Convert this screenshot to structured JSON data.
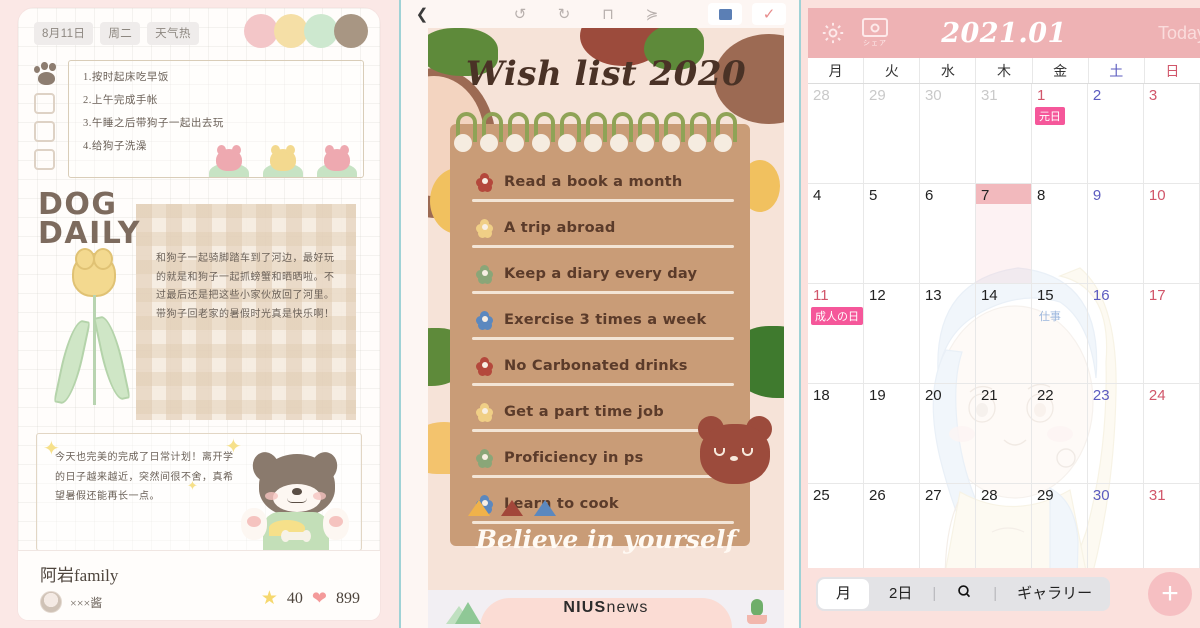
{
  "panel_journal": {
    "tags": [
      "8月11日",
      "周二",
      "天气热"
    ],
    "dot_colors": [
      "#f3c6c8",
      "#f5dfa6",
      "#cde8cf",
      "#a89683"
    ],
    "checklist": [
      "1.按时起床吃早饭",
      "2.上午完成手帐",
      "3.午睡之后带狗子一起出去玩",
      "4.给狗子洗澡"
    ],
    "title_line1": "DOG",
    "title_line2": "DAILY",
    "body_text": "和狗子一起骑脚踏车到了河边，最好玩的就是和狗子一起抓螃蟹和晒晒啦。不过最后还是把这些小家伙放回了河里。带狗子回老家的暑假时光真是快乐啊！",
    "note2_text": "今天也完美的完成了日常计划！离开学的日子越来越近，突然间很不舍，真希望暑假还能再长一点。",
    "user_name": "阿岩family",
    "sub_name": "×××酱",
    "star_count": "40",
    "heart_count": "899",
    "star_icon": "star-icon",
    "heart_icon": "heart-icon",
    "paw_icon": "paw-print-icon",
    "tulip_colors": [
      "#eea9b0",
      "#f3d98f",
      "#eea9b0"
    ]
  },
  "panel_wishlist": {
    "toolbar": [
      {
        "name": "back-arrow-icon",
        "glyph": "❮"
      },
      {
        "name": "undo-icon",
        "glyph": "↺"
      },
      {
        "name": "redo-icon",
        "glyph": "↻"
      },
      {
        "name": "crop-frame-icon",
        "glyph": "⊓"
      },
      {
        "name": "layers-icon",
        "glyph": "❯"
      }
    ],
    "title": "Wish list 2020",
    "items": [
      {
        "text": "Read a book a month",
        "dot": "#b4483c"
      },
      {
        "text": "A trip abroad",
        "dot": "#f0cf86"
      },
      {
        "text": "Keep a diary every day",
        "dot": "#8aa678"
      },
      {
        "text": "Exercise 3 times a week",
        "dot": "#5b88bf"
      },
      {
        "text": "No Carbonated drinks",
        "dot": "#b4483c"
      },
      {
        "text": "Get a part time job",
        "dot": "#f0cf86"
      },
      {
        "text": "Proficiency in ps",
        "dot": "#8aa678"
      },
      {
        "text": "Learn to cook",
        "dot": "#5b88bf"
      }
    ],
    "footer_motto": "Believe in yourself",
    "triangle_colors": [
      "#f0b24a",
      "#a2473a",
      "#5b88bf"
    ],
    "brand_bold": "NIUS",
    "brand_light": "news",
    "canvas_bg": "#f6e3d8",
    "pad_bg": "#c99c77"
  },
  "panel_calendar": {
    "gear_icon": "gear-icon",
    "camera_icon": "camera-icon",
    "camera_label": "シェア",
    "title": "2021.01",
    "today_label": "Today",
    "weekdays": [
      "月",
      "火",
      "水",
      "木",
      "金",
      "土",
      "日"
    ],
    "weeks": [
      [
        {
          "day": "28",
          "muted": true
        },
        {
          "day": "29",
          "muted": true
        },
        {
          "day": "30",
          "muted": true
        },
        {
          "day": "31",
          "muted": true
        },
        {
          "day": "1",
          "color": "#d1566a",
          "event": "元日",
          "event_style": "pink"
        },
        {
          "day": "2",
          "color": "#5b5bbf"
        },
        {
          "day": "3",
          "color": "#d1566a"
        }
      ],
      [
        {
          "day": "4"
        },
        {
          "day": "5"
        },
        {
          "day": "6"
        },
        {
          "day": "7",
          "today": true
        },
        {
          "day": "8"
        },
        {
          "day": "9",
          "color": "#5b5bbf"
        },
        {
          "day": "10",
          "color": "#d1566a"
        }
      ],
      [
        {
          "day": "11",
          "color": "#d1566a",
          "event": "成人の日",
          "event_style": "pink"
        },
        {
          "day": "12"
        },
        {
          "day": "13"
        },
        {
          "day": "14"
        },
        {
          "day": "15",
          "event": "仕事",
          "event_style": "plain"
        },
        {
          "day": "16",
          "color": "#5b5bbf"
        },
        {
          "day": "17",
          "color": "#d1566a"
        }
      ],
      [
        {
          "day": "18"
        },
        {
          "day": "19"
        },
        {
          "day": "20"
        },
        {
          "day": "21"
        },
        {
          "day": "22"
        },
        {
          "day": "23",
          "color": "#5b5bbf"
        },
        {
          "day": "24",
          "color": "#d1566a"
        }
      ],
      [
        {
          "day": "25"
        },
        {
          "day": "26"
        },
        {
          "day": "27"
        },
        {
          "day": "28"
        },
        {
          "day": "29"
        },
        {
          "day": "30",
          "color": "#5b5bbf"
        },
        {
          "day": "31",
          "color": "#d1566a"
        }
      ]
    ],
    "footer": {
      "month_tab": "月",
      "two_day_tab": "2日",
      "search_icon": "search-icon",
      "gallery_tab": "ギャラリー",
      "add_button": "+"
    },
    "header_bg": "#eeb2b4",
    "accent": "#f5579a"
  }
}
